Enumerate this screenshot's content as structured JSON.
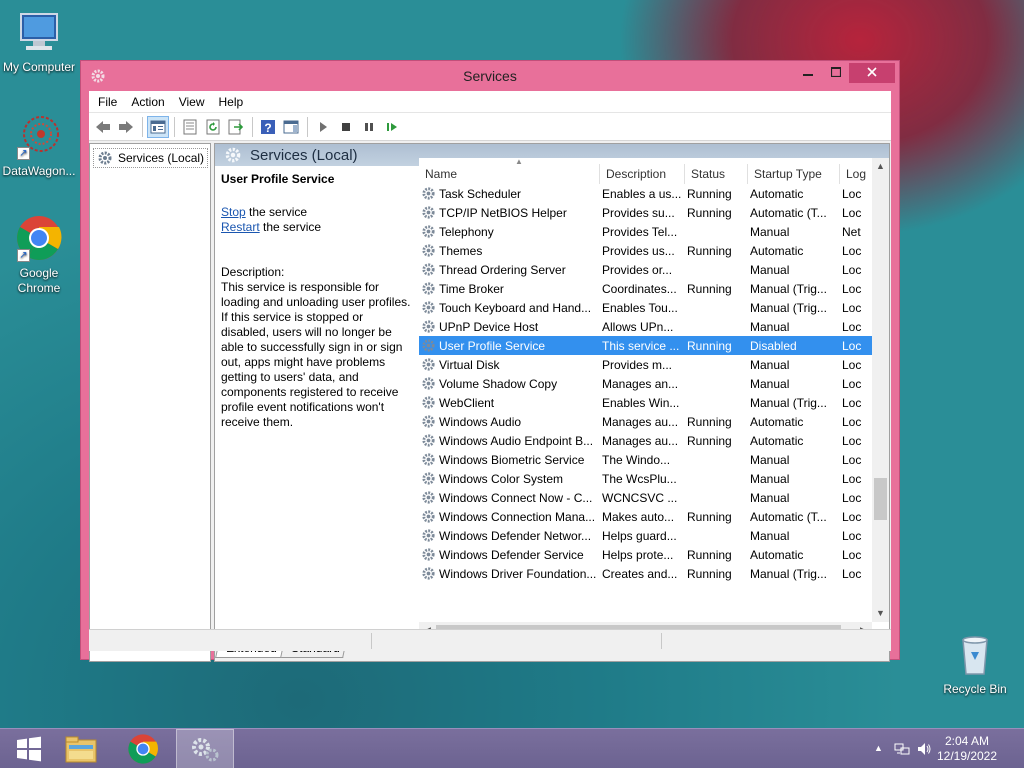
{
  "desktop": {
    "icons": [
      {
        "label": "My Computer"
      },
      {
        "label": "DataWagon..."
      },
      {
        "label": "Google Chrome"
      },
      {
        "label": "Recycle Bin"
      }
    ]
  },
  "window": {
    "title": "Services",
    "menu": [
      "File",
      "Action",
      "View",
      "Help"
    ],
    "tree": {
      "root": "Services (Local)"
    },
    "pane_header": "Services (Local)",
    "extended": {
      "service_name": "User Profile Service",
      "stop_link": "Stop",
      "stop_suffix": " the service",
      "restart_link": "Restart",
      "restart_suffix": " the service",
      "description_label": "Description:",
      "description_text": "This service is responsible for loading and unloading user profiles. If this service is stopped or disabled, users will no longer be able to successfully sign in or sign out, apps might have problems getting to users' data, and components registered to receive profile event notifications won't receive them."
    },
    "columns": [
      "Name",
      "Description",
      "Status",
      "Startup Type",
      "Log"
    ],
    "rows": [
      {
        "name": "Task Scheduler",
        "desc": "Enables a us...",
        "status": "Running",
        "startup": "Automatic",
        "log": "Loc"
      },
      {
        "name": "TCP/IP NetBIOS Helper",
        "desc": "Provides su...",
        "status": "Running",
        "startup": "Automatic (T...",
        "log": "Loc"
      },
      {
        "name": "Telephony",
        "desc": "Provides Tel...",
        "status": "",
        "startup": "Manual",
        "log": "Net"
      },
      {
        "name": "Themes",
        "desc": "Provides us...",
        "status": "Running",
        "startup": "Automatic",
        "log": "Loc"
      },
      {
        "name": "Thread Ordering Server",
        "desc": "Provides or...",
        "status": "",
        "startup": "Manual",
        "log": "Loc"
      },
      {
        "name": "Time Broker",
        "desc": "Coordinates...",
        "status": "Running",
        "startup": "Manual (Trig...",
        "log": "Loc"
      },
      {
        "name": "Touch Keyboard and Hand...",
        "desc": "Enables Tou...",
        "status": "",
        "startup": "Manual (Trig...",
        "log": "Loc"
      },
      {
        "name": "UPnP Device Host",
        "desc": "Allows UPn...",
        "status": "",
        "startup": "Manual",
        "log": "Loc"
      },
      {
        "name": "User Profile Service",
        "desc": "This service ...",
        "status": "Running",
        "startup": "Disabled",
        "log": "Loc",
        "selected": true
      },
      {
        "name": "Virtual Disk",
        "desc": "Provides m...",
        "status": "",
        "startup": "Manual",
        "log": "Loc"
      },
      {
        "name": "Volume Shadow Copy",
        "desc": "Manages an...",
        "status": "",
        "startup": "Manual",
        "log": "Loc"
      },
      {
        "name": "WebClient",
        "desc": "Enables Win...",
        "status": "",
        "startup": "Manual (Trig...",
        "log": "Loc"
      },
      {
        "name": "Windows Audio",
        "desc": "Manages au...",
        "status": "Running",
        "startup": "Automatic",
        "log": "Loc"
      },
      {
        "name": "Windows Audio Endpoint B...",
        "desc": "Manages au...",
        "status": "Running",
        "startup": "Automatic",
        "log": "Loc"
      },
      {
        "name": "Windows Biometric Service",
        "desc": "The Windo...",
        "status": "",
        "startup": "Manual",
        "log": "Loc"
      },
      {
        "name": "Windows Color System",
        "desc": "The WcsPlu...",
        "status": "",
        "startup": "Manual",
        "log": "Loc"
      },
      {
        "name": "Windows Connect Now - C...",
        "desc": "WCNCSVC ...",
        "status": "",
        "startup": "Manual",
        "log": "Loc"
      },
      {
        "name": "Windows Connection Mana...",
        "desc": "Makes auto...",
        "status": "Running",
        "startup": "Automatic (T...",
        "log": "Loc"
      },
      {
        "name": "Windows Defender Networ...",
        "desc": "Helps guard...",
        "status": "",
        "startup": "Manual",
        "log": "Loc"
      },
      {
        "name": "Windows Defender Service",
        "desc": "Helps prote...",
        "status": "Running",
        "startup": "Automatic",
        "log": "Loc"
      },
      {
        "name": "Windows Driver Foundation...",
        "desc": "Creates and...",
        "status": "Running",
        "startup": "Manual (Trig...",
        "log": "Loc"
      }
    ],
    "tabs": [
      "Extended",
      "Standard"
    ]
  },
  "taskbar": {
    "time": "2:04 AM",
    "date": "12/19/2022"
  },
  "colors": {
    "window_frame": "#e8709a",
    "selection": "#3390ee",
    "taskbar": "#6c6391"
  }
}
